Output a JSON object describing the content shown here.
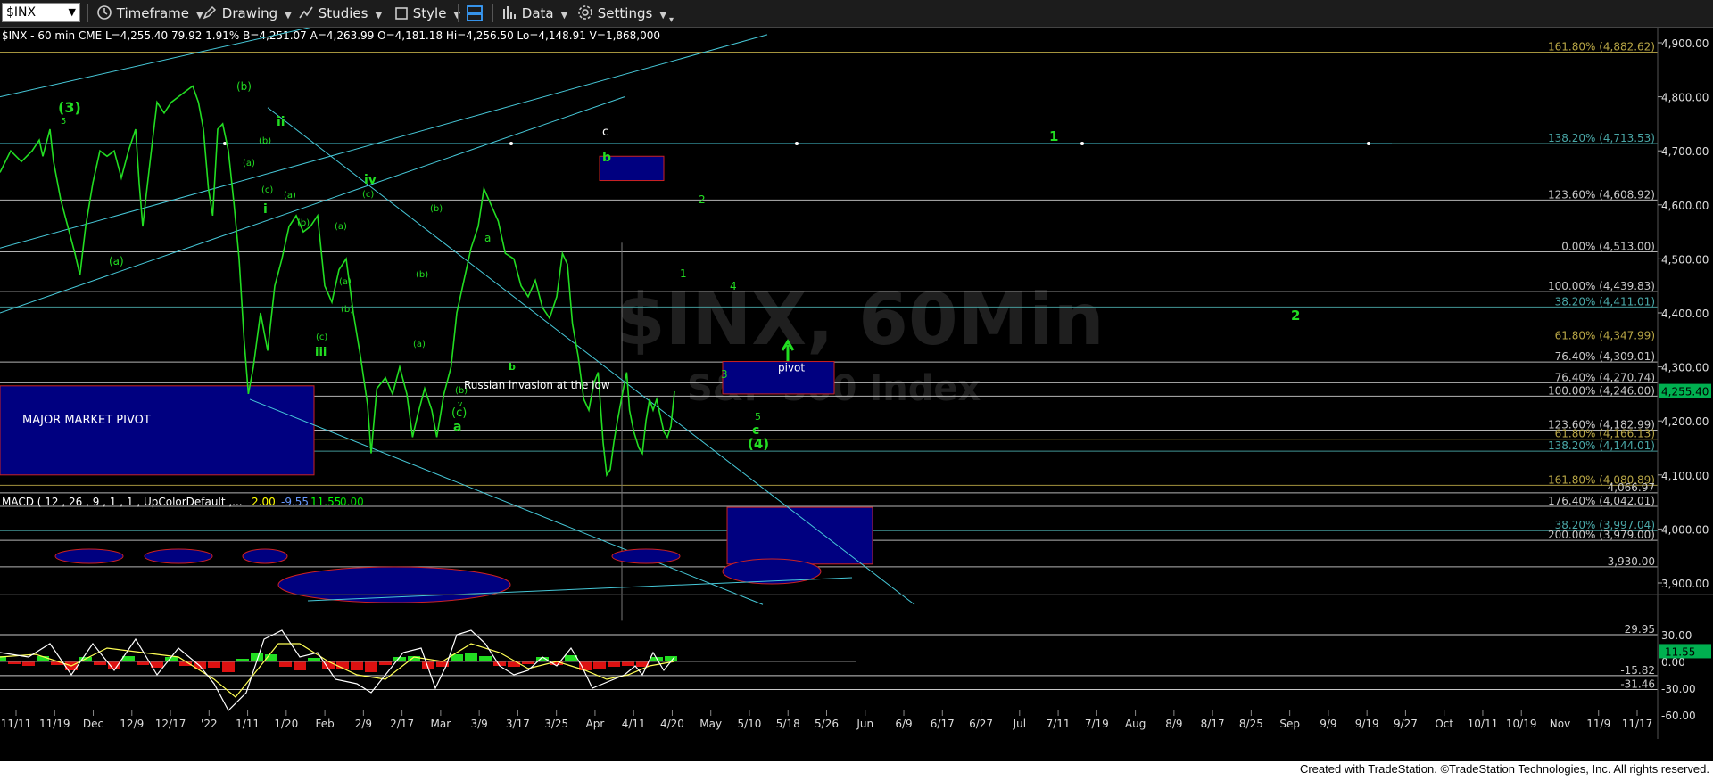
{
  "toolbar": {
    "symbol": "$INX",
    "timeframe": "Timeframe",
    "drawing": "Drawing",
    "studies": "Studies",
    "style": "Style",
    "data": "Data",
    "settings": "Settings"
  },
  "chart_data": [
    {
      "type": "line",
      "info_header": "$INX - 60 min  CME  L=4,255.40  79.92  1.91%  B=4,251.07  A=4,263.99  O=4,181.18  Hi=4,256.50  Lo=4,148.91  V=1,868,000",
      "watermark_line1": "$INX, 60Min",
      "watermark_line2": "S&P 500 Index",
      "y_axis_ticks": [
        3900,
        4000,
        4100,
        4200,
        4300,
        4400,
        4500,
        4600,
        4700,
        4800,
        4900
      ],
      "y_tick_labels": [
        "3,900.00",
        "4,000.00",
        "4,100.00",
        "4,200.00",
        "4,300.00",
        "4,400.00",
        "4,500.00",
        "4,600.00",
        "4,700.00",
        "4,800.00",
        "4,900.00"
      ],
      "ylim": [
        3870,
        4935
      ],
      "last_price": 4255.4,
      "last_price_label": "4,255.40",
      "x_tick_labels": [
        "11/11",
        "11/19",
        "Dec",
        "12/9",
        "12/17",
        "'22",
        "1/11",
        "1/20",
        "Feb",
        "2/9",
        "2/17",
        "Mar",
        "3/9",
        "3/17",
        "3/25",
        "Apr",
        "4/11",
        "4/20",
        "May",
        "5/10",
        "5/18",
        "5/26",
        "Jun",
        "6/9",
        "6/17",
        "6/27",
        "Jul",
        "7/11",
        "7/19",
        "Aug",
        "8/9",
        "8/17",
        "8/25",
        "Sep",
        "9/9",
        "9/19",
        "9/27",
        "Oct",
        "10/11",
        "10/19",
        "Nov",
        "11/9",
        "11/17"
      ],
      "series": [
        {
          "color": "#22dd22",
          "points": [
            [
              0,
              4660
            ],
            [
              15,
              4700
            ],
            [
              30,
              4680
            ],
            [
              45,
              4700
            ],
            [
              55,
              4720
            ],
            [
              60,
              4690
            ],
            [
              70,
              4740
            ],
            [
              75,
              4680
            ],
            [
              85,
              4610
            ],
            [
              95,
              4560
            ],
            [
              105,
              4510
            ],
            [
              112,
              4470
            ],
            [
              120,
              4560
            ],
            [
              130,
              4640
            ],
            [
              140,
              4700
            ],
            [
              150,
              4690
            ],
            [
              160,
              4700
            ],
            [
              170,
              4650
            ],
            [
              180,
              4700
            ],
            [
              190,
              4740
            ],
            [
              195,
              4640
            ],
            [
              200,
              4560
            ],
            [
              205,
              4620
            ],
            [
              212,
              4700
            ],
            [
              220,
              4790
            ],
            [
              230,
              4770
            ],
            [
              240,
              4790
            ],
            [
              250,
              4800
            ],
            [
              260,
              4810
            ],
            [
              270,
              4820
            ],
            [
              278,
              4790
            ],
            [
              285,
              4740
            ],
            [
              292,
              4630
            ],
            [
              298,
              4580
            ],
            [
              305,
              4740
            ],
            [
              312,
              4750
            ],
            [
              320,
              4700
            ],
            [
              328,
              4600
            ],
            [
              335,
              4500
            ],
            [
              342,
              4350
            ],
            [
              348,
              4250
            ],
            [
              355,
              4300
            ],
            [
              365,
              4400
            ],
            [
              375,
              4330
            ],
            [
              385,
              4450
            ],
            [
              395,
              4500
            ],
            [
              405,
              4560
            ],
            [
              415,
              4580
            ],
            [
              425,
              4550
            ],
            [
              435,
              4560
            ],
            [
              445,
              4580
            ],
            [
              455,
              4450
            ],
            [
              465,
              4420
            ],
            [
              475,
              4480
            ],
            [
              485,
              4500
            ],
            [
              495,
              4400
            ],
            [
              505,
              4320
            ],
            [
              515,
              4230
            ],
            [
              520,
              4140
            ],
            [
              528,
              4260
            ],
            [
              540,
              4280
            ],
            [
              550,
              4250
            ],
            [
              560,
              4300
            ],
            [
              570,
              4250
            ],
            [
              578,
              4170
            ],
            [
              585,
              4210
            ],
            [
              595,
              4260
            ],
            [
              605,
              4220
            ],
            [
              612,
              4170
            ],
            [
              622,
              4250
            ],
            [
              632,
              4300
            ],
            [
              640,
              4400
            ],
            [
              650,
              4460
            ],
            [
              660,
              4520
            ],
            [
              670,
              4560
            ],
            [
              678,
              4630
            ],
            [
              688,
              4600
            ],
            [
              698,
              4570
            ],
            [
              708,
              4510
            ],
            [
              720,
              4500
            ],
            [
              730,
              4450
            ],
            [
              740,
              4430
            ],
            [
              750,
              4460
            ],
            [
              760,
              4410
            ],
            [
              770,
              4390
            ],
            [
              780,
              4430
            ],
            [
              788,
              4510
            ],
            [
              795,
              4490
            ],
            [
              802,
              4380
            ],
            [
              810,
              4320
            ],
            [
              818,
              4240
            ],
            [
              825,
              4220
            ],
            [
              832,
              4270
            ],
            [
              838,
              4290
            ],
            [
              845,
              4160
            ],
            [
              850,
              4100
            ],
            [
              855,
              4110
            ],
            [
              860,
              4160
            ],
            [
              865,
              4200
            ],
            [
              872,
              4250
            ],
            [
              878,
              4290
            ],
            [
              882,
              4220
            ],
            [
              888,
              4180
            ],
            [
              895,
              4150
            ],
            [
              900,
              4140
            ],
            [
              905,
              4200
            ],
            [
              910,
              4240
            ],
            [
              915,
              4220
            ],
            [
              920,
              4240
            ],
            [
              925,
              4210
            ],
            [
              930,
              4180
            ],
            [
              935,
              4170
            ],
            [
              940,
              4190
            ],
            [
              945,
              4255
            ]
          ]
        }
      ]
    },
    {
      "type": "line",
      "title": "MACD ( 12 , 26 , 9 , 1 , 1 , UpColorDefault ,...",
      "legend_values": [
        "2.00",
        "-9.55",
        "11.55",
        "0.00"
      ],
      "legend_colors": [
        "#ffff00",
        "#6699ff",
        "#00ff00",
        "#00dd00"
      ],
      "y_axis_ticks": [
        -60,
        -30,
        0,
        30
      ],
      "y_tick_labels": [
        "-60.00",
        "-30.00",
        "0.00",
        "30.00"
      ],
      "ylim": [
        -72,
        45
      ],
      "reference_values": [
        29.95,
        -15.82,
        -31.46
      ],
      "reference_labels": [
        "29.95",
        "-15.82",
        "-31.46"
      ],
      "current_value": 11.55,
      "current_label": "11.55",
      "macd": [
        [
          0,
          10
        ],
        [
          40,
          5
        ],
        [
          70,
          20
        ],
        [
          100,
          -15
        ],
        [
          130,
          20
        ],
        [
          160,
          -10
        ],
        [
          190,
          25
        ],
        [
          220,
          -15
        ],
        [
          250,
          15
        ],
        [
          280,
          -5
        ],
        [
          300,
          -25
        ],
        [
          320,
          -55
        ],
        [
          345,
          -35
        ],
        [
          370,
          25
        ],
        [
          395,
          35
        ],
        [
          420,
          5
        ],
        [
          445,
          10
        ],
        [
          470,
          -20
        ],
        [
          500,
          -25
        ],
        [
          520,
          -35
        ],
        [
          540,
          -15
        ],
        [
          565,
          10
        ],
        [
          590,
          15
        ],
        [
          610,
          -30
        ],
        [
          625,
          -5
        ],
        [
          640,
          30
        ],
        [
          660,
          35
        ],
        [
          680,
          20
        ],
        [
          700,
          -5
        ],
        [
          720,
          -15
        ],
        [
          740,
          -10
        ],
        [
          760,
          5
        ],
        [
          780,
          -5
        ],
        [
          800,
          15
        ],
        [
          815,
          -5
        ],
        [
          830,
          -30
        ],
        [
          845,
          -25
        ],
        [
          860,
          -20
        ],
        [
          875,
          -15
        ],
        [
          890,
          -5
        ],
        [
          900,
          -15
        ],
        [
          915,
          10
        ],
        [
          930,
          -10
        ],
        [
          945,
          5
        ]
      ],
      "signal": [
        [
          0,
          5
        ],
        [
          50,
          8
        ],
        [
          100,
          -5
        ],
        [
          150,
          15
        ],
        [
          200,
          10
        ],
        [
          250,
          5
        ],
        [
          300,
          -20
        ],
        [
          330,
          -40
        ],
        [
          360,
          -10
        ],
        [
          390,
          20
        ],
        [
          420,
          20
        ],
        [
          460,
          0
        ],
        [
          500,
          -15
        ],
        [
          540,
          -20
        ],
        [
          580,
          5
        ],
        [
          620,
          0
        ],
        [
          660,
          20
        ],
        [
          700,
          10
        ],
        [
          740,
          -8
        ],
        [
          780,
          0
        ],
        [
          820,
          -10
        ],
        [
          850,
          -20
        ],
        [
          880,
          -15
        ],
        [
          910,
          -5
        ],
        [
          945,
          0
        ]
      ],
      "histogram": [
        [
          0,
          6
        ],
        [
          20,
          -3
        ],
        [
          40,
          -5
        ],
        [
          60,
          6
        ],
        [
          80,
          -4
        ],
        [
          100,
          -10
        ],
        [
          120,
          5
        ],
        [
          140,
          -4
        ],
        [
          160,
          -8
        ],
        [
          180,
          6
        ],
        [
          200,
          -4
        ],
        [
          220,
          -7
        ],
        [
          240,
          5
        ],
        [
          260,
          -5
        ],
        [
          280,
          -9
        ],
        [
          300,
          -7
        ],
        [
          320,
          -12
        ],
        [
          340,
          3
        ],
        [
          360,
          10
        ],
        [
          380,
          8
        ],
        [
          400,
          -6
        ],
        [
          420,
          -10
        ],
        [
          440,
          4
        ],
        [
          460,
          -8
        ],
        [
          480,
          -9
        ],
        [
          500,
          -10
        ],
        [
          520,
          -12
        ],
        [
          540,
          -4
        ],
        [
          560,
          5
        ],
        [
          580,
          6
        ],
        [
          600,
          -9
        ],
        [
          620,
          -6
        ],
        [
          640,
          8
        ],
        [
          660,
          9
        ],
        [
          680,
          6
        ],
        [
          700,
          -5
        ],
        [
          720,
          -6
        ],
        [
          740,
          -3
        ],
        [
          760,
          5
        ],
        [
          780,
          -4
        ],
        [
          800,
          7
        ],
        [
          820,
          -10
        ],
        [
          840,
          -8
        ],
        [
          860,
          -6
        ],
        [
          880,
          -5
        ],
        [
          900,
          -6
        ],
        [
          920,
          5
        ],
        [
          940,
          6
        ]
      ]
    }
  ],
  "fib_levels": [
    {
      "label": "161.80% (4,882.62)",
      "value": 4882.62,
      "color": "#b7a545"
    },
    {
      "label": "138.20% (4,713.53)",
      "value": 4713.53,
      "color": "#4aa8a8"
    },
    {
      "label": "123.60% (4,608.92)",
      "value": 4608.92,
      "color": "#c8c8c8"
    },
    {
      "label": "0.00% (4,513.00)",
      "value": 4513.0,
      "color": "#c8c8c8"
    },
    {
      "label": "100.00% (4,439.83)",
      "value": 4439.83,
      "color": "#c8c8c8"
    },
    {
      "label": "38.20% (4,411.01)",
      "value": 4411.01,
      "color": "#4aa8a8"
    },
    {
      "label": "61.80% (4,347.99)",
      "value": 4347.99,
      "color": "#b7a545"
    },
    {
      "label": "76.40% (4,309.01)",
      "value": 4309.01,
      "color": "#c8c8c8"
    },
    {
      "label": "76.40% (4,270.74)",
      "value": 4270.74,
      "color": "#c8c8c8"
    },
    {
      "label": "100.00% (4,246.00)",
      "value": 4246.0,
      "color": "#c8c8c8"
    },
    {
      "label": "123.60% (4,182.99)",
      "value": 4182.99,
      "color": "#c8c8c8"
    },
    {
      "label": "61.80% (4,166.13)",
      "value": 4166.13,
      "color": "#b7a545"
    },
    {
      "label": "138.20% (4,144.01)",
      "value": 4144.01,
      "color": "#4aa8a8"
    },
    {
      "label": "161.80% (4,080.89)",
      "value": 4080.89,
      "color": "#b7a545"
    },
    {
      "label": "4,066.97",
      "value": 4066.97,
      "color": "#c8c8c8"
    },
    {
      "label": "176.40% (4,042.01)",
      "value": 4042.01,
      "color": "#c8c8c8"
    },
    {
      "label": "38.20% (3,997.04)",
      "value": 3997.04,
      "color": "#4aa8a8"
    },
    {
      "label": "200.00% (3,979.00)",
      "value": 3979.0,
      "color": "#c8c8c8"
    },
    {
      "label": "3,930.00",
      "value": 3930.0,
      "color": "#c8c8c8"
    }
  ],
  "annotations": {
    "major_market_pivot": "MAJOR MARKET PIVOT",
    "pivot": "pivot",
    "russian_invasion": "Russian invasion at the low",
    "waves": [
      "(3)",
      "5",
      "(b)",
      "ii",
      "(b)",
      "(a)",
      "(c)",
      "(a)",
      "i",
      "(b)",
      "(a)",
      "(c)",
      "iii",
      "iv",
      "(c)",
      "(b)",
      "(a)",
      "(a)",
      "(b)",
      "(b)",
      "(a)",
      "a",
      "b",
      "(b)",
      "(c)",
      "v",
      "a",
      "b",
      "c",
      "2",
      "1",
      "4",
      "3",
      "5",
      "c",
      "(4)",
      "1",
      "2"
    ]
  },
  "footer": {
    "credit": "Created with TradeStation. ©TradeStation Technologies, Inc. All rights reserved."
  }
}
